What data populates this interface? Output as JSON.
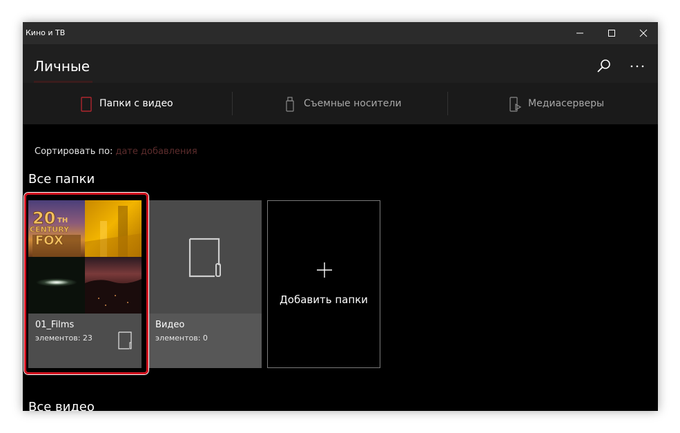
{
  "app": {
    "title": "Кино и ТВ"
  },
  "window_controls": {
    "minimize_icon": "minimize-icon",
    "maximize_icon": "maximize-icon",
    "close_icon": "close-icon"
  },
  "header": {
    "title": "Личные",
    "search_icon": "search-icon",
    "more_icon": "more-dots-icon"
  },
  "tabs": [
    {
      "label": "Папки с видео",
      "icon": "folder-icon",
      "selected": true
    },
    {
      "label": "Съемные носители",
      "icon": "usb-drive-icon",
      "selected": false
    },
    {
      "label": "Медиасерверы",
      "icon": "media-server-icon",
      "selected": false
    }
  ],
  "sort": {
    "label": "Сортировать по:",
    "value": "дате добавления"
  },
  "sections": {
    "folders_title": "Все папки",
    "videos_title": "Все видео"
  },
  "folders": [
    {
      "name": "01_Films",
      "count": "элементов: 23"
    },
    {
      "name": "Видео",
      "count": "элементов: 0"
    }
  ],
  "add_tile": {
    "label": "Добавить папки",
    "icon": "plus-icon"
  },
  "colors": {
    "accent": "#d2121f",
    "sort_value": "#5c2c2c",
    "tile_bg": "#4d4d4d"
  },
  "thumbnail_text": {
    "logo": "20 CENTURY FOX"
  }
}
